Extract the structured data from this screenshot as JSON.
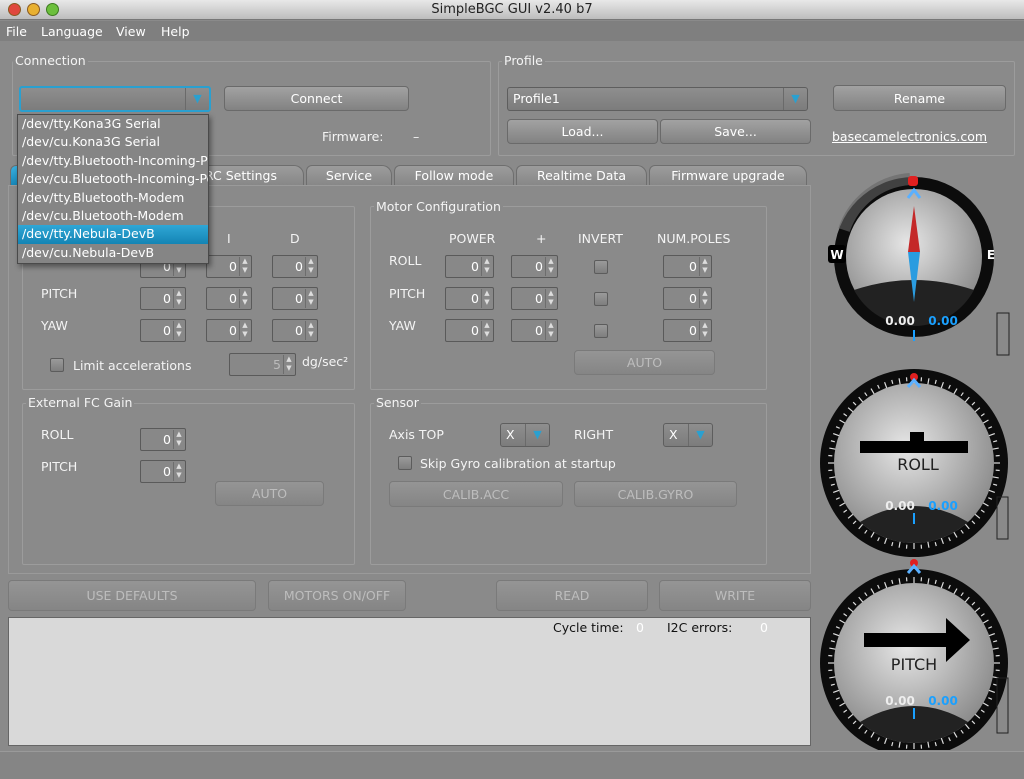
{
  "window": {
    "title": "SimpleBGC GUI v2.40 b7"
  },
  "menu": [
    "File",
    "Language",
    "View",
    "Help"
  ],
  "connection": {
    "label": "Connection",
    "port_value": "",
    "connect": "Connect",
    "firmware_label": "Firmware:",
    "firmware_value": "–",
    "ports": [
      "/dev/tty.Kona3G Serial",
      "/dev/cu.Kona3G Serial",
      "/dev/tty.Bluetooth-Incoming-Port",
      "/dev/cu.Bluetooth-Incoming-Port",
      "/dev/tty.Bluetooth-Modem",
      "/dev/cu.Bluetooth-Modem",
      "/dev/tty.Nebula-DevB",
      "/dev/cu.Nebula-DevB"
    ],
    "selected_port": "/dev/tty.Nebula-DevB"
  },
  "profile": {
    "label": "Profile",
    "value": "Profile1",
    "rename": "Rename",
    "load": "Load...",
    "save": "Save...",
    "link": "basecamelectronics.com"
  },
  "tabs": [
    "RC Settings",
    "Service",
    "Follow mode",
    "Realtime Data",
    "Firmware upgrade"
  ],
  "pid": {
    "headers": [
      "I",
      "D"
    ],
    "rows": [
      {
        "label": "ROLL",
        "p": "0",
        "i": "0",
        "d": "0"
      },
      {
        "label": "PITCH",
        "p": "0",
        "i": "0",
        "d": "0"
      },
      {
        "label": "YAW",
        "p": "0",
        "i": "0",
        "d": "0"
      }
    ],
    "limit_label": "Limit accelerations",
    "limit_value": "5",
    "limit_unit": "dg/sec²"
  },
  "motor": {
    "label": "Motor Configuration",
    "headers": [
      "POWER",
      "+",
      "INVERT",
      "NUM.POLES"
    ],
    "rows": [
      {
        "label": "ROLL",
        "power": "0",
        "plus": "0",
        "poles": "0"
      },
      {
        "label": "PITCH",
        "power": "0",
        "plus": "0",
        "poles": "0"
      },
      {
        "label": "YAW",
        "power": "0",
        "plus": "0",
        "poles": "0"
      }
    ],
    "auto": "AUTO"
  },
  "ext": {
    "label": "External FC Gain",
    "rows": [
      {
        "label": "ROLL",
        "value": "0"
      },
      {
        "label": "PITCH",
        "value": "0"
      }
    ],
    "auto": "AUTO"
  },
  "sensor": {
    "label": "Sensor",
    "axis_top_label": "Axis TOP",
    "axis_top": "X",
    "right_label": "RIGHT",
    "right": "X",
    "skip_gyro": "Skip Gyro calibration at startup",
    "calib_acc": "CALIB.ACC",
    "calib_gyro": "CALIB.GYRO"
  },
  "actions": {
    "defaults": "USE DEFAULTS",
    "motors": "MOTORS ON/OFF",
    "read": "READ",
    "write": "WRITE"
  },
  "status": {
    "cycle_label": "Cycle time:",
    "cycle": "0",
    "i2c_label": "I2C errors:",
    "i2c": "0"
  },
  "gauges": {
    "yaw": {
      "west": "W",
      "east": "E",
      "v1": "0.00",
      "v2": "0.00"
    },
    "roll": {
      "label": "ROLL",
      "v1": "0.00",
      "v2": "0.00"
    },
    "pitch": {
      "label": "PITCH",
      "v1": "0.00",
      "v2": "0.00"
    }
  },
  "colors": {
    "accent": "#1e9ad0",
    "value_blue": "#1aa0ff"
  }
}
